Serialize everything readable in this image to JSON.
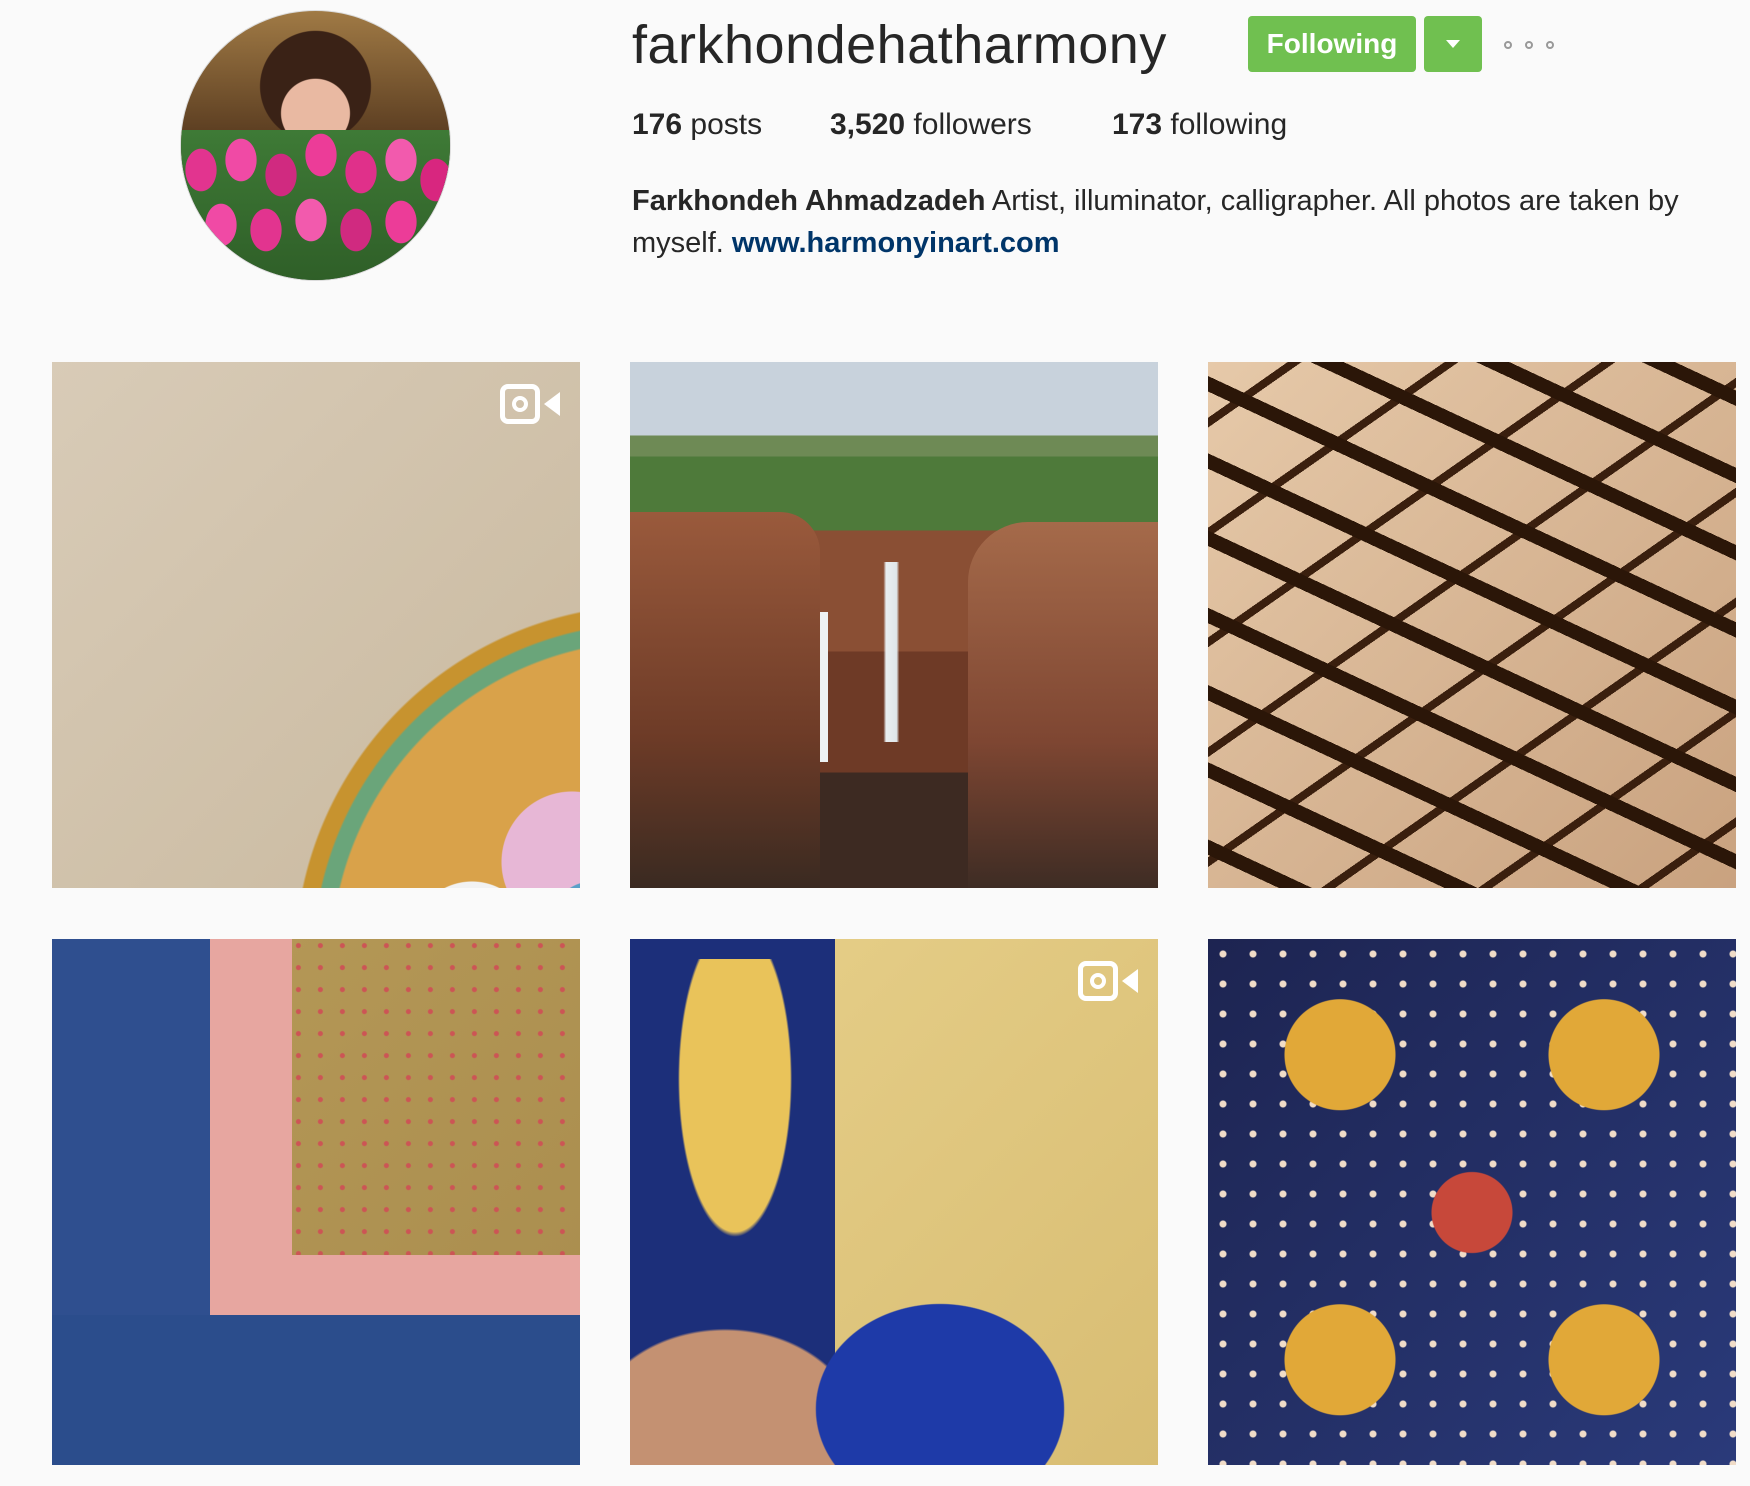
{
  "profile": {
    "username": "farkhondehatharmony",
    "follow_button": "Following",
    "stats": {
      "posts_count": "176",
      "posts_label": "posts",
      "followers_count": "3,520",
      "followers_label": "followers",
      "following_count": "173",
      "following_label": "following"
    },
    "bio": {
      "full_name": "Farkhondeh Ahmadzadeh",
      "text": "Artist, illuminator, calligrapher. All photos are taken by myself.",
      "website": "www.harmonyinart.com"
    }
  },
  "posts": [
    {
      "kind": "video",
      "icon": "video-icon"
    },
    {
      "kind": "photo"
    },
    {
      "kind": "photo"
    },
    {
      "kind": "photo"
    },
    {
      "kind": "video",
      "icon": "video-icon"
    },
    {
      "kind": "photo"
    }
  ],
  "colors": {
    "follow_button": "#70c050",
    "link": "#003569",
    "background": "#fafafa"
  }
}
